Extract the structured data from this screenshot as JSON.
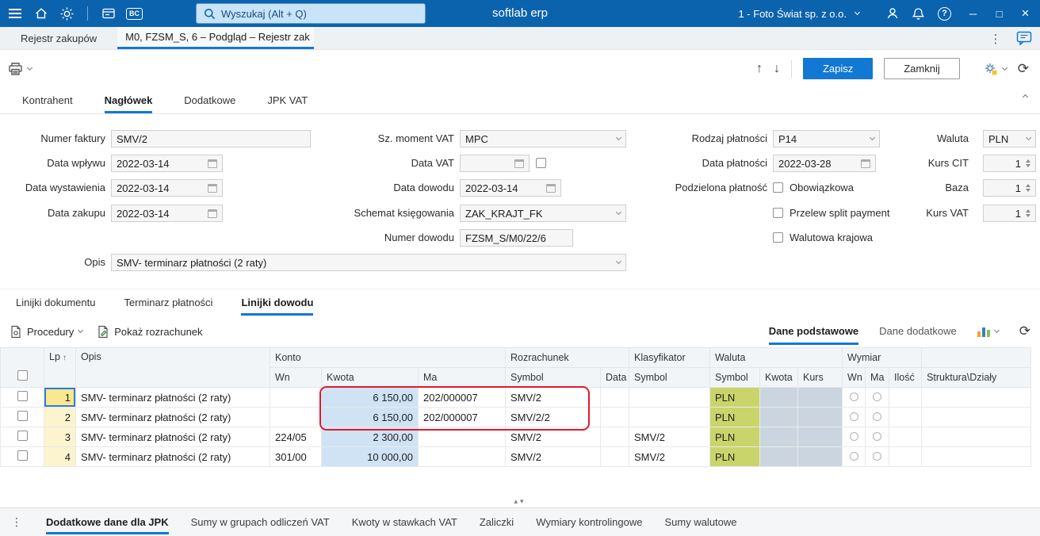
{
  "icons": {
    "arrow_up": "↑",
    "arrow_down": "↓",
    "refresh": "⟳",
    "dots_vertical": "⋮",
    "minimize": "─",
    "maximize": "□",
    "close": "×",
    "sort_asc": "↑",
    "splitter_handle": "▴▾",
    "help": "?"
  },
  "colors": {
    "accent": "#1178d4",
    "topbar": "#0b63ae",
    "kwota_cell": "#cfe3f5",
    "waluta_cell": "#cbd5e0",
    "pln_cell": "#c9d56b",
    "annotation": "#df1a2e"
  },
  "topbar": {
    "bc_badge": "BC",
    "search_placeholder": "Wyszukaj (Alt + Q)",
    "app_title": "softlab erp",
    "company": "1 - Foto Świat sp. z o.o."
  },
  "tabstrip": {
    "tab_rejestr": "Rejestr zakupów",
    "tab_active": "M0, FZSM_S, 6 – Podgląd – Rejestr zak"
  },
  "toolbar": {
    "save": "Zapisz",
    "close": "Zamknij"
  },
  "header_tabs": {
    "kontrahent": "Kontrahent",
    "naglowek": "Nagłówek",
    "dodatkowe": "Dodatkowe",
    "jpk": "JPK VAT"
  },
  "form": {
    "numer_faktury_label": "Numer faktury",
    "numer_faktury_value": "SMV/2",
    "data_wplywu_label": "Data wpływu",
    "data_wplywu_value": "2022-03-14",
    "data_wystawienia_label": "Data wystawienia",
    "data_wystawienia_value": "2022-03-14",
    "data_zakupu_label": "Data zakupu",
    "data_zakupu_value": "2022-03-14",
    "opis_label": "Opis",
    "opis_value": "SMV- terminarz płatności (2 raty)",
    "sz_moment_vat_label": "Sz. moment VAT",
    "sz_moment_vat_value": "MPC",
    "data_vat_label": "Data VAT",
    "data_vat_value": "",
    "data_dowodu_label": "Data dowodu",
    "data_dowodu_value": "2022-03-14",
    "schemat_label": "Schemat księgowania",
    "schemat_value": "ZAK_KRAJT_FK",
    "numer_dowodu_label": "Numer dowodu",
    "numer_dowodu_value": "FZSM_S/M0/22/6",
    "rodzaj_platnosci_label": "Rodzaj płatności",
    "rodzaj_platnosci_value": "P14",
    "data_platnosci_label": "Data płatności",
    "data_platnosci_value": "2022-03-28",
    "podzielona_label": "Podzielona płatność",
    "obowiazkowa_label": "Obowiązkowa",
    "przelew_label": "Przelew split payment",
    "walutowa_label": "Walutowa krajowa",
    "waluta_label": "Waluta",
    "waluta_value": "PLN",
    "kurs_cit_label": "Kurs CIT",
    "kurs_cit_value": "1",
    "baza_label": "Baza",
    "baza_value": "1",
    "kurs_vat_label": "Kurs VAT",
    "kurs_vat_value": "1"
  },
  "detail_tabs": {
    "linijki_dokumentu": "Linijki dokumentu",
    "terminarz": "Terminarz płatności",
    "linijki_dowodu": "Linijki dowodu"
  },
  "grid_toolbar": {
    "procedury": "Procedury",
    "pokaz_rozrachunek": "Pokaż rozrachunek",
    "dane_podstawowe": "Dane podstawowe",
    "dane_dodatkowe": "Dane dodatkowe"
  },
  "table": {
    "headers": {
      "lp": "Lp",
      "opis": "Opis",
      "konto": "Konto",
      "wn": "Wn",
      "kwota": "Kwota",
      "ma": "Ma",
      "rozrachunek": "Rozrachunek",
      "symbol": "Symbol",
      "data": "Data",
      "klasyfikator": "Klasyfikator",
      "waluta": "Waluta",
      "kurs": "Kurs",
      "wymiar": "Wymiar",
      "ilosc": "Ilość",
      "struktura": "Struktura\\Działy"
    },
    "rows": [
      {
        "lp": "1",
        "opis": "SMV- terminarz płatności (2 raty)",
        "wn": "",
        "kwota": "6 150,00",
        "ma": "202/000007",
        "rozrachunek_symbol": "SMV/2",
        "rozrachunek_data": "",
        "klasyfikator_symbol": "",
        "waluta_symbol": "PLN",
        "waluta_kwota": "",
        "kurs": "",
        "ilosc": "",
        "struktura": ""
      },
      {
        "lp": "2",
        "opis": "SMV- terminarz płatności (2 raty)",
        "wn": "",
        "kwota": "6 150,00",
        "ma": "202/000007",
        "rozrachunek_symbol": "SMV/2/2",
        "rozrachunek_data": "",
        "klasyfikator_symbol": "",
        "waluta_symbol": "PLN",
        "waluta_kwota": "",
        "kurs": "",
        "ilosc": "",
        "struktura": ""
      },
      {
        "lp": "3",
        "opis": "SMV- terminarz płatności (2 raty)",
        "wn": "224/05",
        "kwota": "2 300,00",
        "ma": "",
        "rozrachunek_symbol": "SMV/2",
        "rozrachunek_data": "",
        "klasyfikator_symbol": "SMV/2",
        "waluta_symbol": "PLN",
        "waluta_kwota": "",
        "kurs": "",
        "ilosc": "",
        "struktura": ""
      },
      {
        "lp": "4",
        "opis": "SMV- terminarz płatności (2 raty)",
        "wn": "301/00",
        "kwota": "10 000,00",
        "ma": "",
        "rozrachunek_symbol": "SMV/2",
        "rozrachunek_data": "",
        "klasyfikator_symbol": "SMV/2",
        "waluta_symbol": "PLN",
        "waluta_kwota": "",
        "kurs": "",
        "ilosc": "",
        "struktura": ""
      }
    ]
  },
  "bottom_tabs": [
    "Dodatkowe dane dla JPK",
    "Sumy w grupach odliczeń VAT",
    "Kwoty w stawkach VAT",
    "Zaliczki",
    "Wymiary kontrolingowe",
    "Sumy walutowe"
  ]
}
